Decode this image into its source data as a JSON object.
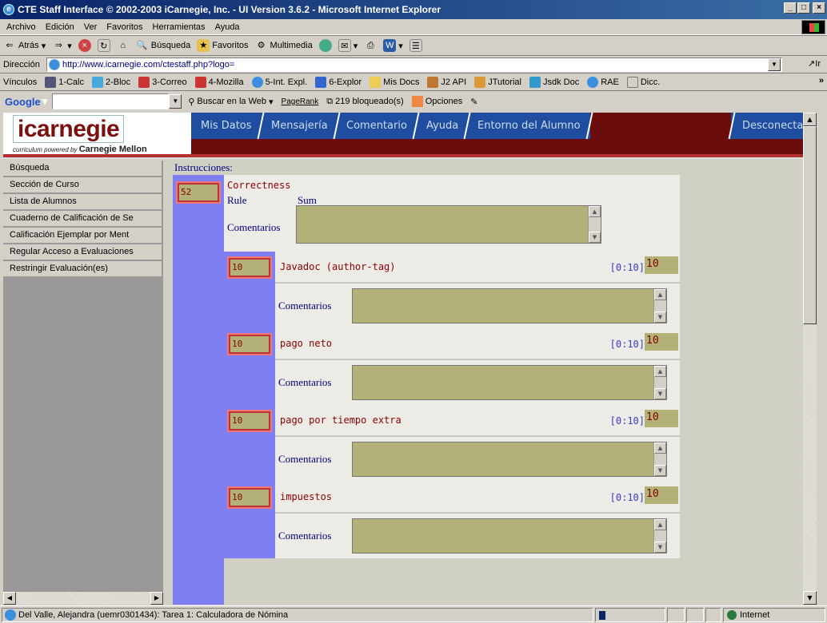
{
  "window": {
    "title": "CTE Staff Interface © 2002-2003 iCarnegie, Inc. - UI Version 3.6.2 - Microsoft Internet Explorer"
  },
  "menu": [
    "Archivo",
    "Edición",
    "Ver",
    "Favoritos",
    "Herramientas",
    "Ayuda"
  ],
  "toolbar": {
    "back": "Atrás",
    "search": "Búsqueda",
    "favorites": "Favoritos",
    "multimedia": "Multimedia"
  },
  "address": {
    "label": "Dirección",
    "url": "http://www.icarnegie.com/ctestaff.php?logo=",
    "go": "Ir"
  },
  "links": {
    "label": "Vínculos",
    "items": [
      "1-Calc",
      "2-Bloc",
      "3-Correo",
      "4-Mozilla",
      "5-Int. Expl.",
      "6-Explor",
      "Mis Docs",
      "J2 API",
      "JTutorial",
      "Jsdk Doc",
      "RAE",
      "Dicc."
    ]
  },
  "google": {
    "logo": "Google",
    "search_web": "Buscar en la Web",
    "pagerank": "PageRank",
    "blocked": "219 bloqueado(s)",
    "options": "Opciones"
  },
  "brand": {
    "logo": "icarnegie",
    "tagline": "curriculum powered by",
    "tagline_bold": "Carnegie Mellon"
  },
  "nav": [
    "Mis Datos",
    "Mensajería",
    "Comentario",
    "Ayuda",
    "Entorno del Alumno"
  ],
  "nav_logout": "Desconectar",
  "sidebar": [
    "Búsqueda",
    "Sección de Curso",
    "Lista de Alumnos",
    "Cuaderno de Calificación de Se",
    "Calificación Ejemplar por Ment",
    "Regular Acceso a Evaluaciones",
    "Restringir Evaluación(es)"
  ],
  "content": {
    "instructions": "Instrucciones:",
    "total_score": "52",
    "section_title": "Correctness",
    "rule_label": "Rule",
    "sum_label": "Sum",
    "comments_label": "Comentarios",
    "criteria": [
      {
        "score": "10",
        "label": "Javadoc (author-tag)",
        "range": "[0:10]",
        "value": "10",
        "comments_label": "Comentarios"
      },
      {
        "score": "10",
        "label": "pago neto",
        "range": "[0:10]",
        "value": "10",
        "comments_label": "Comentarios"
      },
      {
        "score": "10",
        "label": "pago por tiempo extra",
        "range": "[0:10]",
        "value": "10",
        "comments_label": "Comentarios"
      },
      {
        "score": "10",
        "label": "impuestos",
        "range": "[0:10]",
        "value": "10",
        "comments_label": "Comentarios"
      }
    ]
  },
  "status": {
    "text": "Del Valle, Alejandra (uemr0301434): Tarea 1: Calculadora de Nómina",
    "zone": "Internet"
  }
}
